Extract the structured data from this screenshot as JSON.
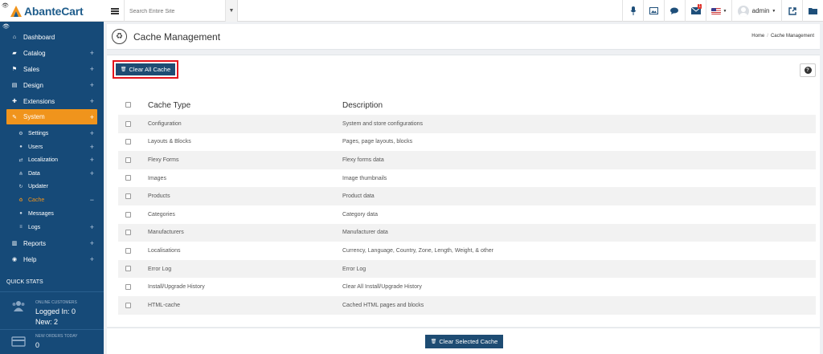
{
  "brand": {
    "name": "AbanteCart"
  },
  "topbar": {
    "search_placeholder": "Search Entire Site",
    "user": "admin",
    "notifications": {
      "messages_count": "",
      "mail_count": "1"
    },
    "icons": [
      "microphone-icon",
      "image-icon",
      "comments-icon",
      "envelope-icon",
      "us-flag-icon",
      "external-link-icon",
      "folder-icon"
    ]
  },
  "sidebar": {
    "items": [
      {
        "label": "Dashboard",
        "icon": "home-icon"
      },
      {
        "label": "Catalog",
        "icon": "folder-icon"
      },
      {
        "label": "Sales",
        "icon": "flag-icon"
      },
      {
        "label": "Design",
        "icon": "file-icon"
      },
      {
        "label": "Extensions",
        "icon": "puzzle-icon"
      },
      {
        "label": "System",
        "icon": "wrench-icon"
      },
      {
        "label": "Reports",
        "icon": "chart-icon"
      },
      {
        "label": "Help",
        "icon": "life-ring-icon"
      }
    ],
    "system_sub": [
      {
        "label": "Settings",
        "icon": "cogs-icon"
      },
      {
        "label": "Users",
        "icon": "users-icon"
      },
      {
        "label": "Localization",
        "icon": "random-icon"
      },
      {
        "label": "Data",
        "icon": "sitemap-icon"
      },
      {
        "label": "Updater",
        "icon": "refresh-icon"
      },
      {
        "label": "Cache",
        "icon": "recycle-icon"
      },
      {
        "label": "Messages",
        "icon": "comments-icon"
      },
      {
        "label": "Logs",
        "icon": "log-icon"
      }
    ],
    "quick_stats": {
      "title": "QUICK STATS",
      "online_label": "ONLINE CUSTOMERS",
      "logged_in": "Logged In: 0",
      "new": "New: 2",
      "orders_label": "NEW ORDERS TODAY",
      "orders_value": "0"
    }
  },
  "header": {
    "title": "Cache Management",
    "breadcrumb": [
      "Home",
      "Cache Management"
    ]
  },
  "toolbar": {
    "clear_all_label": "Clear All Cache",
    "help_label": "?"
  },
  "table": {
    "headers": {
      "type": "Cache Type",
      "description": "Description"
    },
    "rows": [
      {
        "type": "Configuration",
        "description": "System and store configurations"
      },
      {
        "type": "Layouts & Blocks",
        "description": "Pages, page layouts, blocks"
      },
      {
        "type": "Flexy Forms",
        "description": "Flexy forms data"
      },
      {
        "type": "Images",
        "description": "Image thumbnails"
      },
      {
        "type": "Products",
        "description": "Product data"
      },
      {
        "type": "Categories",
        "description": "Category data"
      },
      {
        "type": "Manufacturers",
        "description": "Manufacturer data"
      },
      {
        "type": "Localisations",
        "description": "Currency, Language, Country, Zone, Length, Weight, & other"
      },
      {
        "type": "Error Log",
        "description": "Error Log"
      },
      {
        "type": "Install/Upgrade History",
        "description": "Clear All Install/Upgrade History"
      },
      {
        "type": "HTML-cache",
        "description": "Cached HTML pages and blocks"
      }
    ]
  },
  "footer": {
    "clear_selected_label": "Clear Selected Cache"
  },
  "colors": {
    "sidebar": "#164a78",
    "accent": "#f0941c",
    "button": "#1e4c73",
    "highlight_border": "#e3141c"
  }
}
